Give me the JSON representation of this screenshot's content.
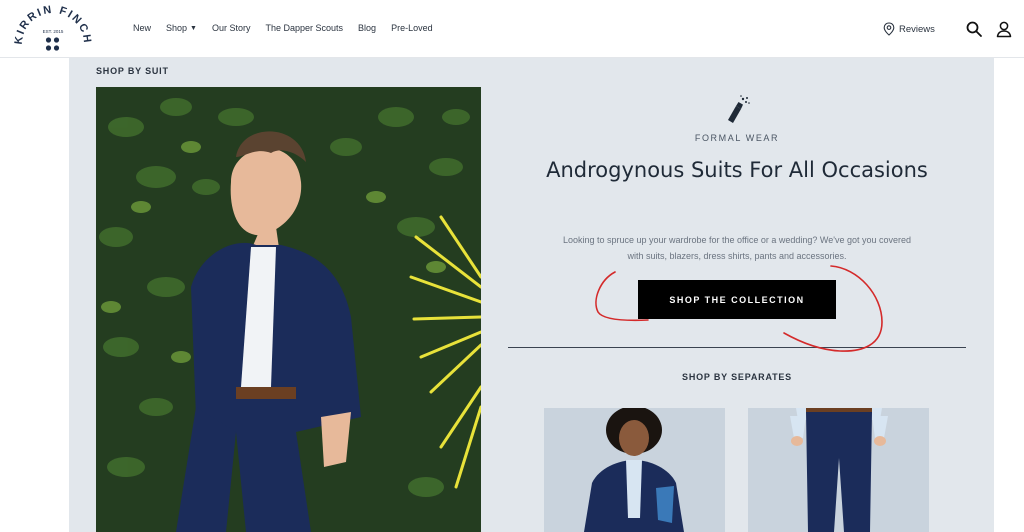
{
  "brand": {
    "name": "KIRRIN FINCH",
    "est": "EST. 2015"
  },
  "nav": {
    "items": [
      {
        "label": "New"
      },
      {
        "label": "Shop",
        "has_dropdown": true
      },
      {
        "label": "Our Story"
      },
      {
        "label": "The Dapper Scouts"
      },
      {
        "label": "Blog"
      },
      {
        "label": "Pre-Loved"
      }
    ],
    "reviews_label": "Reviews"
  },
  "main": {
    "shop_by_suit_label": "SHOP BY SUIT",
    "eyebrow": "FORMAL WEAR",
    "headline": "Androgynous Suits For All Occasions",
    "description": "Looking to spruce up your wardrobe for the office or a wedding? We've got you covered with suits, blazers, dress shirts, pants and accessories.",
    "cta_label": "SHOP THE COLLECTION",
    "separates_label": "SHOP BY SEPARATES"
  },
  "colors": {
    "panel_bg": "#e2e7ec",
    "cta_bg": "#000000",
    "annotation": "#d42a2a",
    "suit_navy": "#1b2c5a"
  }
}
